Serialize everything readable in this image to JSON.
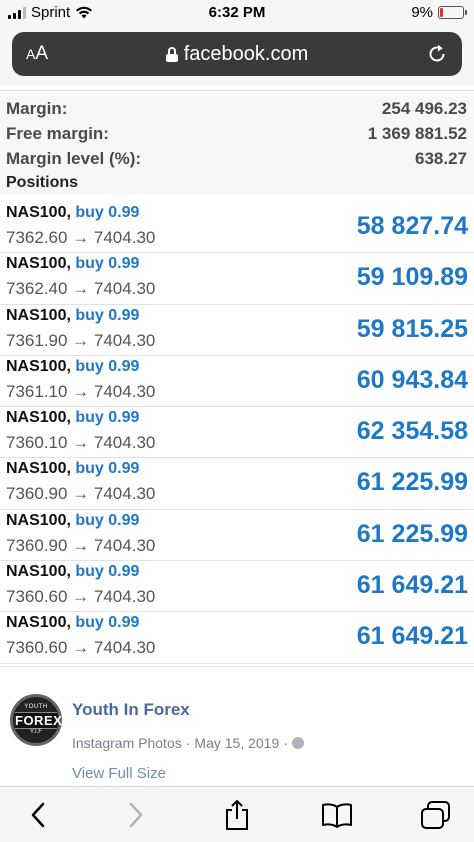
{
  "status_bar": {
    "carrier": "Sprint",
    "time": "6:32 PM",
    "battery_percent": "9%",
    "battery_level": 0.09,
    "battery_color": "#e5302b"
  },
  "address_bar": {
    "text_size_label": "AA",
    "url": "facebook.com"
  },
  "summary": {
    "margin_label": "Margin:",
    "margin_value": "254 496.23",
    "free_margin_label": "Free margin:",
    "free_margin_value": "1 369 881.52",
    "margin_level_label": "Margin level (%):",
    "margin_level_value": "638.27"
  },
  "positions_header": "Positions",
  "positions": [
    {
      "symbol": "NAS100,",
      "side": "buy 0.99",
      "prices": "7362.60 → 7404.30",
      "profit": "58 827.74"
    },
    {
      "symbol": "NAS100,",
      "side": "buy 0.99",
      "prices": "7362.40 → 7404.30",
      "profit": "59 109.89"
    },
    {
      "symbol": "NAS100,",
      "side": "buy 0.99",
      "prices": "7361.90 → 7404.30",
      "profit": "59 815.25"
    },
    {
      "symbol": "NAS100,",
      "side": "buy 0.99",
      "prices": "7361.10 → 7404.30",
      "profit": "60 943.84"
    },
    {
      "symbol": "NAS100,",
      "side": "buy 0.99",
      "prices": "7360.10 → 7404.30",
      "profit": "62 354.58"
    },
    {
      "symbol": "NAS100,",
      "side": "buy 0.99",
      "prices": "7360.90 → 7404.30",
      "profit": "61 225.99"
    },
    {
      "symbol": "NAS100,",
      "side": "buy 0.99",
      "prices": "7360.90 → 7404.30",
      "profit": "61 225.99"
    },
    {
      "symbol": "NAS100,",
      "side": "buy 0.99",
      "prices": "7360.60 → 7404.30",
      "profit": "61 649.21"
    },
    {
      "symbol": "NAS100,",
      "side": "buy 0.99",
      "prices": "7360.60 → 7404.30",
      "profit": "61 649.21"
    }
  ],
  "post": {
    "author": "Youth In Forex",
    "source": "Instagram Photos",
    "date": "May 15, 2019",
    "view_full_size": "View Full Size",
    "avatar_top": "YOUTH",
    "avatar_main": "FOREX",
    "avatar_bottom": "Y.I.F"
  },
  "toolbar": {
    "icons": [
      "back-icon",
      "forward-icon",
      "share-icon",
      "bookmarks-icon",
      "tabs-icon"
    ]
  },
  "colors": {
    "accent_blue": "#1e78c8",
    "author_link": "#4a6a9a"
  }
}
